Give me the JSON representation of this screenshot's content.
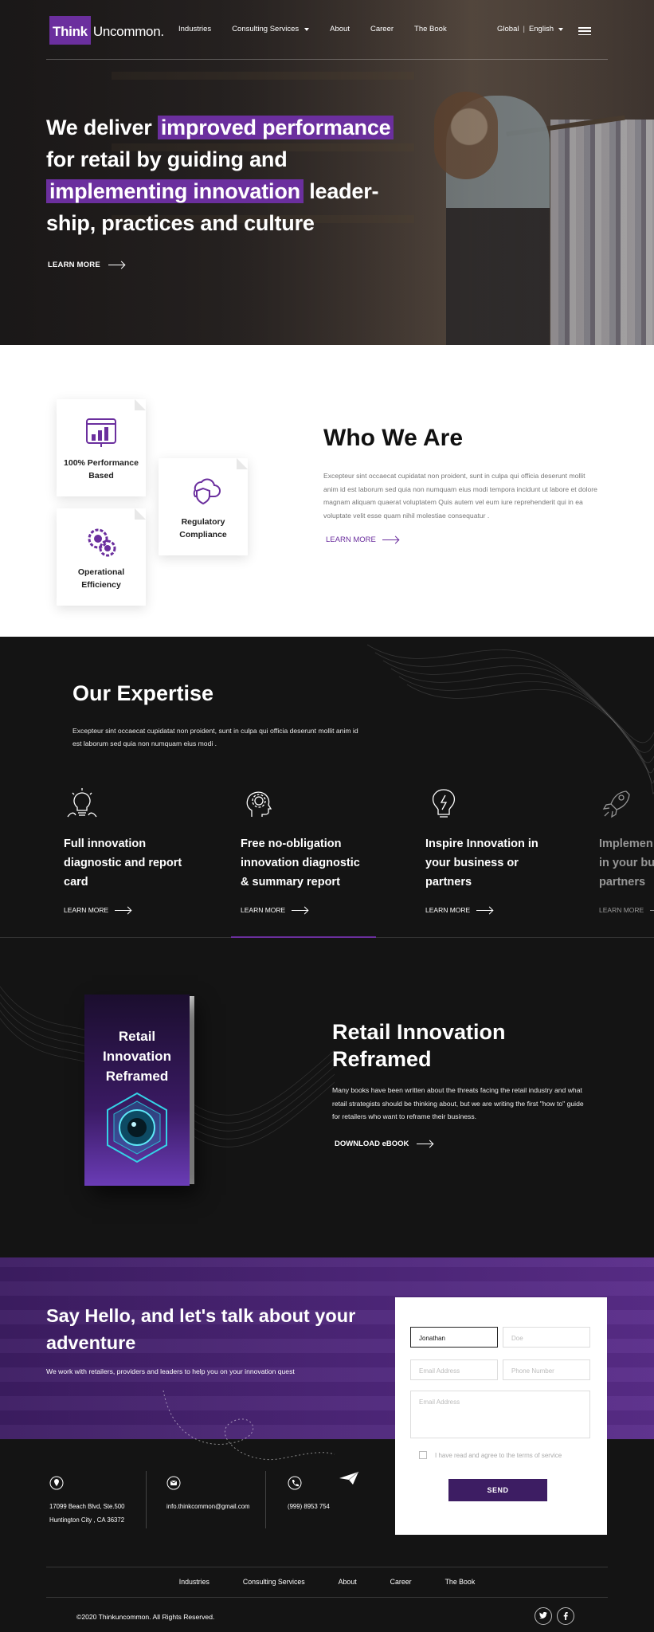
{
  "brand": {
    "logo_part1": "Think",
    "logo_part2": "Uncommon.",
    "accent": "#6b2f9e"
  },
  "nav": {
    "items": [
      "Industries",
      "Consulting Services",
      "About",
      "Career",
      "The Book"
    ],
    "language_region": "Global",
    "language": "English"
  },
  "hero": {
    "line1_pre": "We deliver ",
    "line1_hl": "improved performance",
    "line2": "for retail by guiding and",
    "line3_hl": "implementing innovation",
    "line3_post": " leader-",
    "line4": "ship, practices and culture",
    "cta": "LEARN MORE"
  },
  "who": {
    "cards": [
      {
        "label_line1": "100% Performance",
        "label_line2": "Based",
        "icon": "chart-icon"
      },
      {
        "label_line1": "Regulatory",
        "label_line2": "Compliance",
        "icon": "shield-cloud-icon"
      },
      {
        "label_line1": "Operational",
        "label_line2": "Efficiency",
        "icon": "gears-icon"
      }
    ],
    "title": "Who We Are",
    "text": "Excepteur sint occaecat cupidatat non proident, sunt in culpa qui officia deserunt mollit anim id est laborum sed quia non numquam eius modi tempora incidunt ut labore et dolore magnam aliquam quaerat voluptatem Quis autem vel eum iure reprehenderit qui in ea voluptate velit esse quam nihil molestiae consequatur .",
    "cta": "LEARN MORE"
  },
  "expertise": {
    "title": "Our Expertise",
    "text": "Excepteur sint occaecat cupidatat non proident, sunt in culpa qui officia deserunt mollit anim id est laborum sed quia non numquam eius modi .",
    "services": [
      {
        "l1": "Full innovation",
        "l2": "diagnostic and report",
        "l3": "card",
        "cta": "LEARN MORE",
        "icon": "lightbulb-icon"
      },
      {
        "l1": "Free no-obligation",
        "l2": "innovation diagnostic",
        "l3": "& summary report",
        "cta": "LEARN MORE",
        "icon": "head-gear-icon"
      },
      {
        "l1": "Inspire Innovation in",
        "l2": "your business or",
        "l3": "partners",
        "cta": "LEARN MORE",
        "icon": "brain-bulb-icon"
      },
      {
        "l1": "Implemen",
        "l2": "in your bu",
        "l3": "partners",
        "cta": "LEARN MORE",
        "icon": "rocket-icon"
      }
    ]
  },
  "book": {
    "cover_l1": "Retail",
    "cover_l2": "Innovation",
    "cover_l3": "Reframed",
    "title_l1": "Retail Innovation",
    "title_l2": "Reframed",
    "text": "Many books have been written about the threats facing the retail industry and what retail strategists should be thinking about, but we are writing the first \"how to\" guide for retailers who want to reframe their business.",
    "cta": "DOWNLOAD eBOOK"
  },
  "contact": {
    "title": "Say Hello, and let's talk about your adventure",
    "text": "We work with retailers, providers and leaders to help you on your innovation quest",
    "form": {
      "name_value": "Jonathan",
      "last_placeholder": "Doe",
      "email_placeholder": "Email Address",
      "phone_placeholder": "Phone Number",
      "message_placeholder": "Email Address",
      "terms": "I have read and agree to the terms of service",
      "send": "SEND"
    },
    "info": {
      "address_l1": "17099 Beach Blvd, Ste.500",
      "address_l2": "Huntington City , CA 36372",
      "email": "info.thinkcommon@gmail.com",
      "phone": "(999) 8953 754"
    }
  },
  "footer": {
    "links": [
      "Industries",
      "Consulting Services",
      "About",
      "Career",
      "The Book"
    ],
    "copyright": "©2020 Thinkuncommon. All Rights Reserved."
  }
}
